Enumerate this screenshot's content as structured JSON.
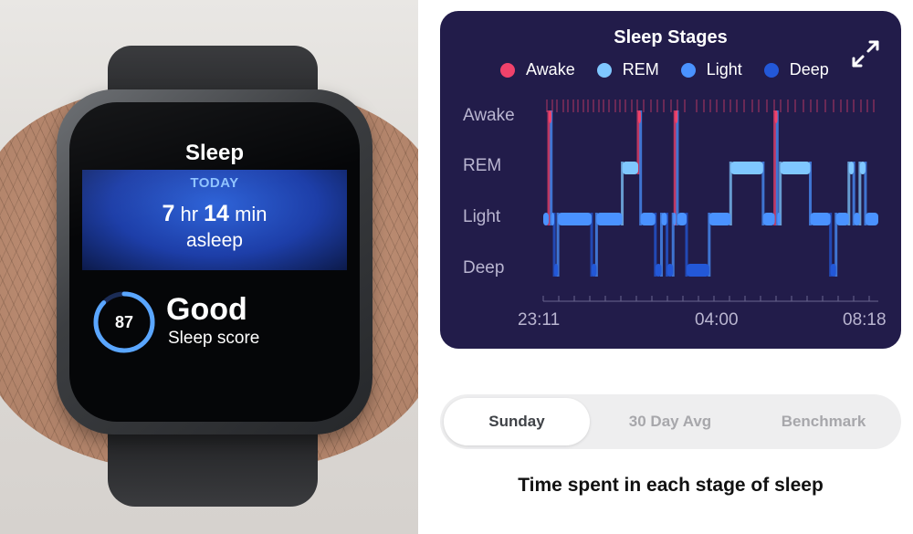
{
  "watch": {
    "title": "Sleep",
    "today_label": "TODAY",
    "duration_hours": "7",
    "duration_hours_unit": "hr",
    "duration_minutes": "14",
    "duration_minutes_unit": "min",
    "asleep_label": "asleep",
    "score_value": "87",
    "score_rating": "Good",
    "score_label": "Sleep score"
  },
  "chart": {
    "title": "Sleep Stages",
    "expand_icon": "expand-arrows-icon",
    "colors": {
      "awake": "#f0426b",
      "rem": "#7fc7ff",
      "light": "#4a92ff",
      "deep": "#2358d8",
      "card_background": "#221c4a"
    }
  },
  "chart_data": {
    "type": "area",
    "title": "Sleep Stages",
    "legend": [
      "Awake",
      "REM",
      "Light",
      "Deep"
    ],
    "legend_position": "top",
    "y_categories": [
      "Awake",
      "REM",
      "Light",
      "Deep"
    ],
    "x_ticks": [
      "23:11",
      "04:00",
      "08:18"
    ],
    "x_range": [
      "23:11",
      "08:18"
    ],
    "series": [
      {
        "name": "Sleep stage",
        "points": [
          {
            "t": "23:11",
            "stage": "Light"
          },
          {
            "t": "23:20",
            "stage": "Awake"
          },
          {
            "t": "23:24",
            "stage": "Light"
          },
          {
            "t": "23:29",
            "stage": "Deep"
          },
          {
            "t": "23:35",
            "stage": "Light"
          },
          {
            "t": "00:30",
            "stage": "Deep"
          },
          {
            "t": "00:38",
            "stage": "Light"
          },
          {
            "t": "01:20",
            "stage": "REM"
          },
          {
            "t": "01:46",
            "stage": "Awake"
          },
          {
            "t": "01:50",
            "stage": "Light"
          },
          {
            "t": "02:14",
            "stage": "Deep"
          },
          {
            "t": "02:24",
            "stage": "Light"
          },
          {
            "t": "02:33",
            "stage": "Deep"
          },
          {
            "t": "02:43",
            "stage": "Light"
          },
          {
            "t": "02:46",
            "stage": "Awake"
          },
          {
            "t": "02:50",
            "stage": "Light"
          },
          {
            "t": "03:05",
            "stage": "Deep"
          },
          {
            "t": "03:42",
            "stage": "Light"
          },
          {
            "t": "04:17",
            "stage": "REM"
          },
          {
            "t": "05:10",
            "stage": "Light"
          },
          {
            "t": "05:29",
            "stage": "Awake"
          },
          {
            "t": "05:33",
            "stage": "Light"
          },
          {
            "t": "05:38",
            "stage": "REM"
          },
          {
            "t": "06:27",
            "stage": "Light"
          },
          {
            "t": "07:00",
            "stage": "Deep"
          },
          {
            "t": "07:09",
            "stage": "Light"
          },
          {
            "t": "07:30",
            "stage": "REM"
          },
          {
            "t": "07:38",
            "stage": "Light"
          },
          {
            "t": "07:48",
            "stage": "REM"
          },
          {
            "t": "07:57",
            "stage": "Light"
          },
          {
            "t": "08:18",
            "stage": "Light"
          }
        ]
      }
    ]
  },
  "tabs": [
    {
      "label": "Sunday",
      "active": true
    },
    {
      "label": "30 Day Avg",
      "active": false
    },
    {
      "label": "Benchmark",
      "active": false
    }
  ],
  "caption": "Time spent in each stage of sleep"
}
